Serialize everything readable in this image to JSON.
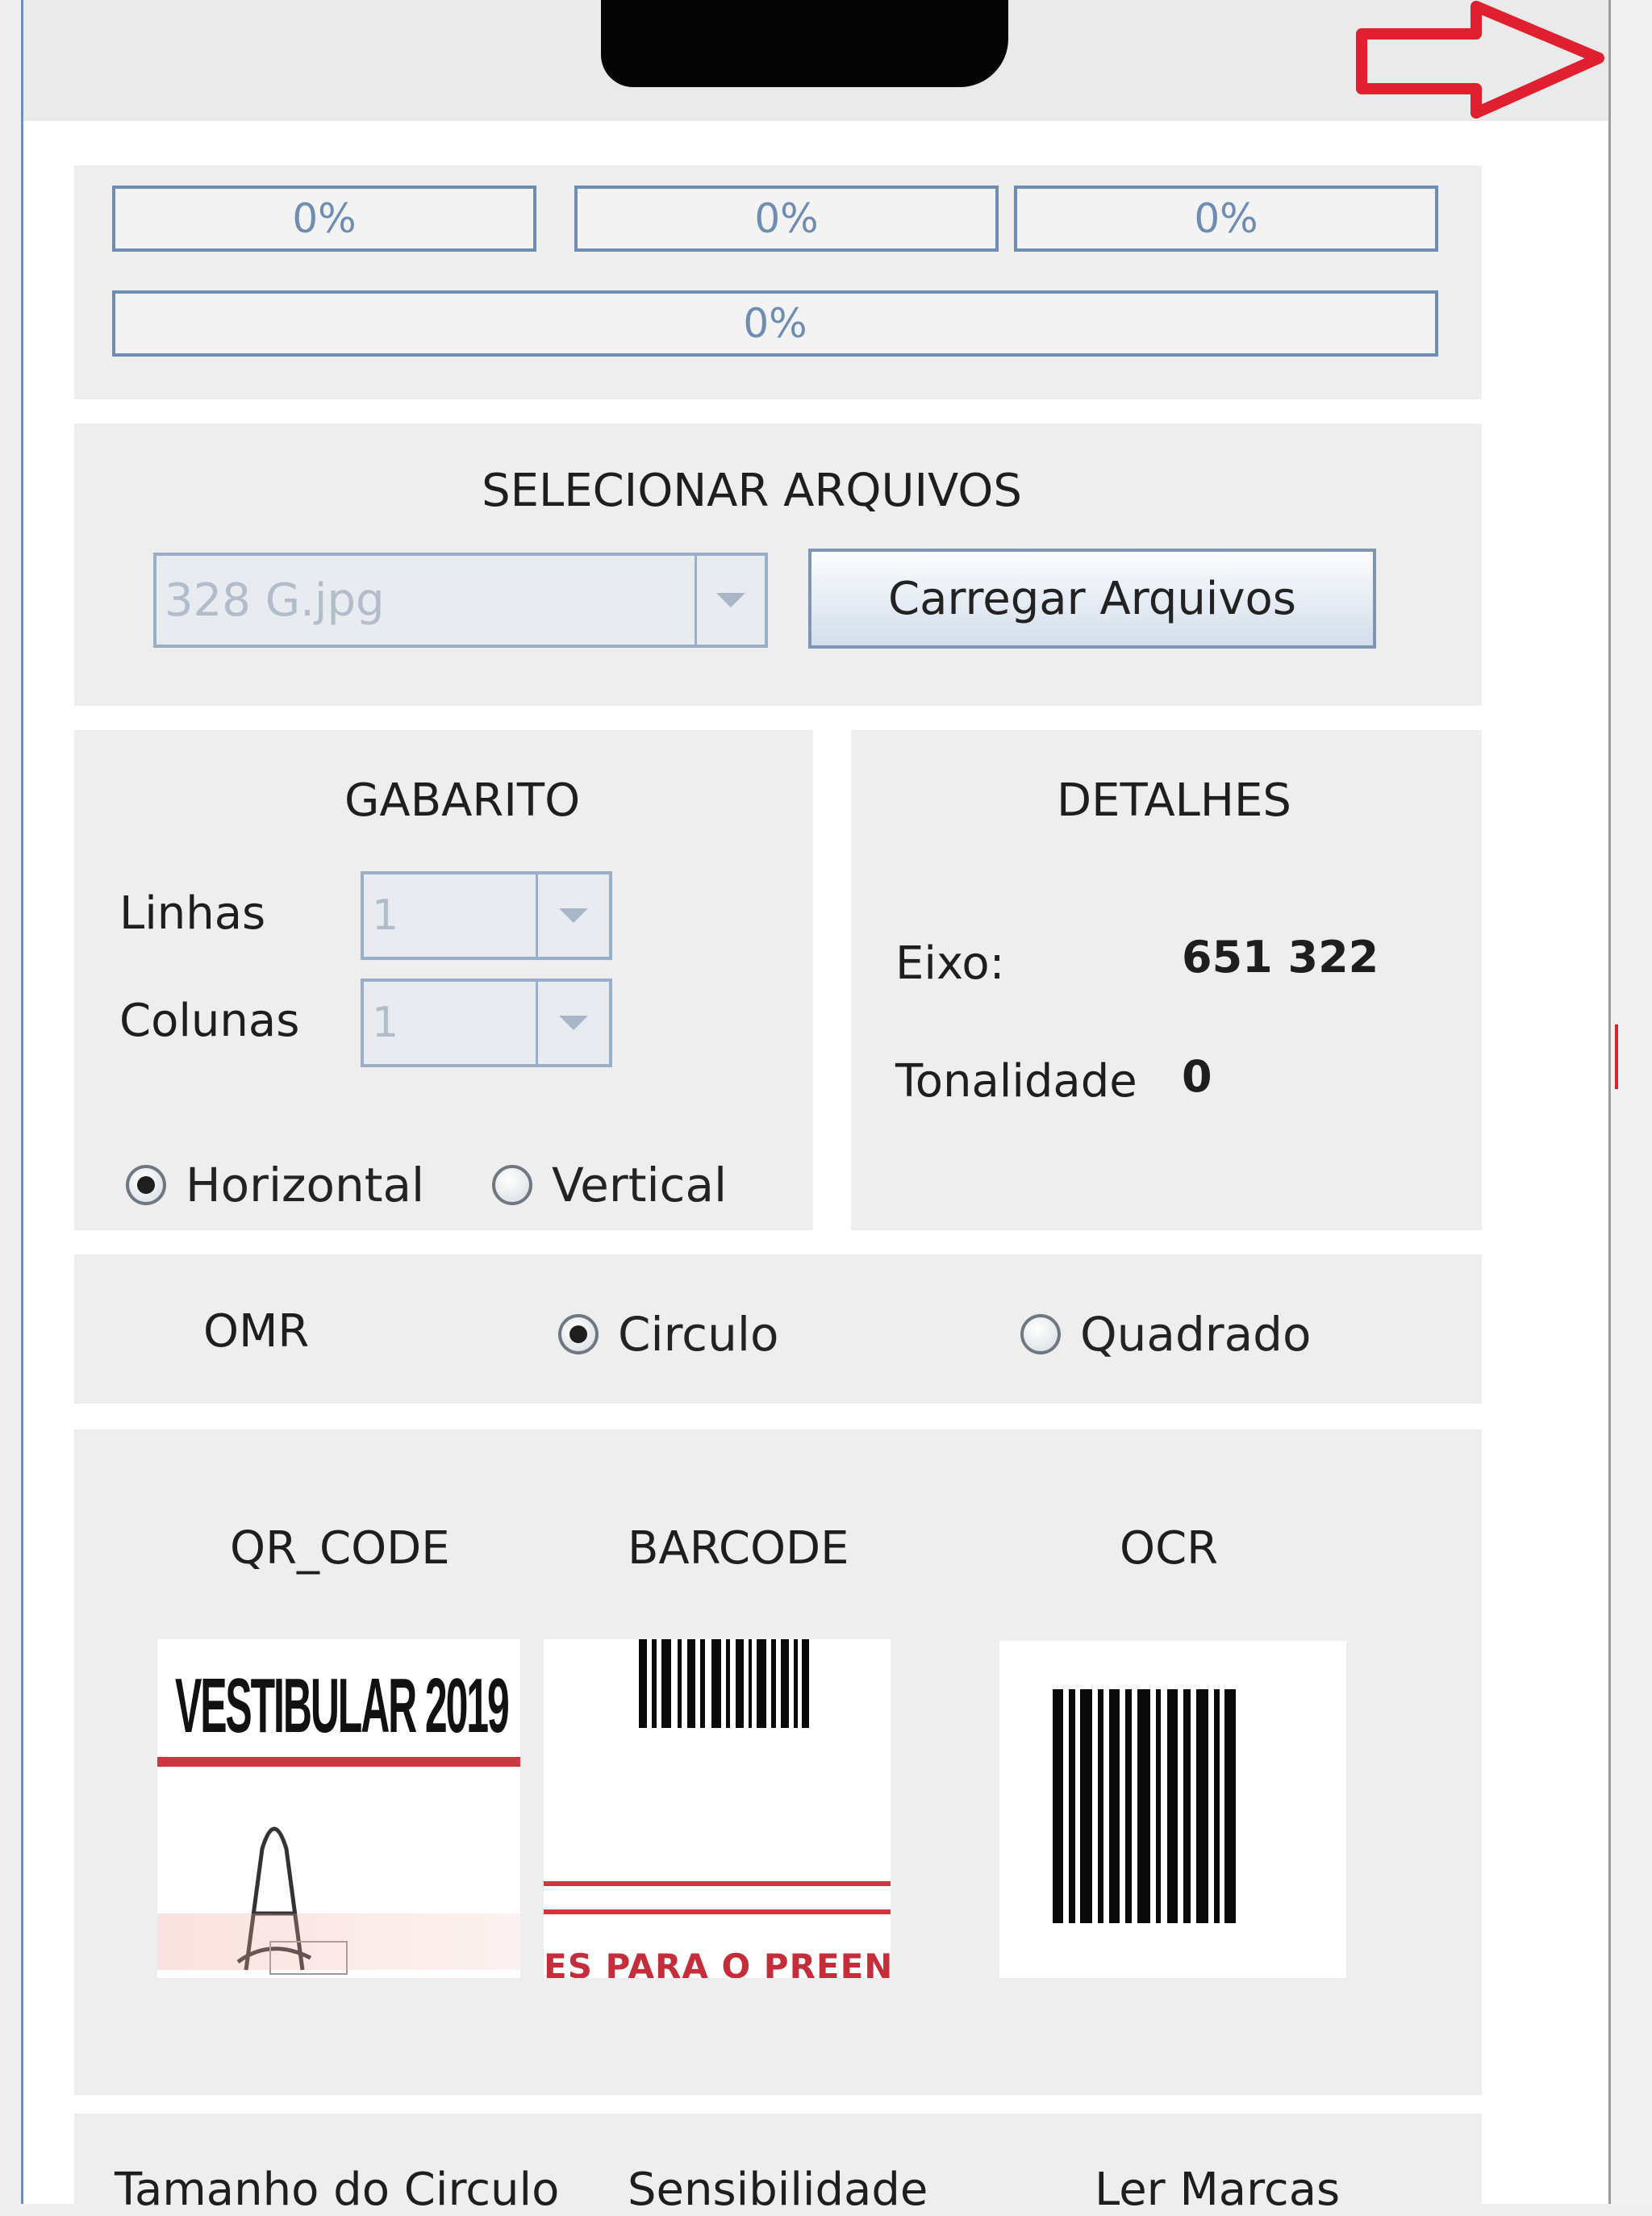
{
  "progress": {
    "bar1": "0%",
    "bar2": "0%",
    "bar3": "0%",
    "overall": "0%",
    "values": [
      0,
      0,
      0,
      0
    ]
  },
  "select_files": {
    "title": "SELECIONAR ARQUIVOS",
    "file_combo_value": "328 G.jpg",
    "load_button": "Carregar Arquivos"
  },
  "gabarito": {
    "title": "GABARITO",
    "rows_label": "Linhas",
    "rows_value": "1",
    "cols_label": "Colunas",
    "cols_value": "1",
    "orientation": {
      "horizontal_label": "Horizontal",
      "vertical_label": "Vertical",
      "selected": "Horizontal"
    }
  },
  "details": {
    "title": "DETALHES",
    "axis_label": "Eixo:",
    "axis_value": "651 322",
    "tone_label": "Tonalidade",
    "tone_value": "0"
  },
  "omr": {
    "label": "OMR",
    "circle_label": "Circulo",
    "square_label": "Quadrado",
    "selected": "Circulo"
  },
  "readers": {
    "qr_title": "QR_CODE",
    "barcode_title": "BARCODE",
    "ocr_title": "OCR",
    "qr_image_text": "VESTIBULAR 2019",
    "barcode_image_text": "ES PARA O PREENCHIN"
  },
  "bottom": {
    "circle_size_label": "Tamanho do Circulo",
    "sensitivity_label": "Sensibilidade",
    "read_marks_label": "Ler Marcas"
  },
  "colors": {
    "progress_border": "#6f8db3",
    "annotation_arrow": "#e02030",
    "window_border": "#6e8fb8"
  },
  "icons": {
    "arrow_annotation": "arrow-right-icon",
    "combo_arrow": "chevron-down-icon"
  }
}
